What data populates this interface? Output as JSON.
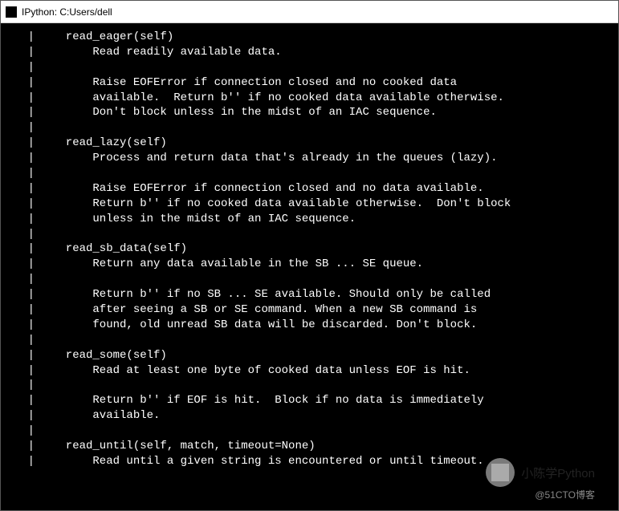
{
  "window": {
    "title": "IPython: C:Users/dell"
  },
  "doc": {
    "sections": [
      {
        "sig": "read_eager(self)",
        "body": [
          "Read readily available data.",
          "",
          "Raise EOFError if connection closed and no cooked data",
          "available.  Return b'' if no cooked data available otherwise.",
          "Don't block unless in the midst of an IAC sequence."
        ]
      },
      {
        "sig": "read_lazy(self)",
        "body": [
          "Process and return data that's already in the queues (lazy).",
          "",
          "Raise EOFError if connection closed and no data available.",
          "Return b'' if no cooked data available otherwise.  Don't block",
          "unless in the midst of an IAC sequence."
        ]
      },
      {
        "sig": "read_sb_data(self)",
        "body": [
          "Return any data available in the SB ... SE queue.",
          "",
          "Return b'' if no SB ... SE available. Should only be called",
          "after seeing a SB or SE command. When a new SB command is",
          "found, old unread SB data will be discarded. Don't block."
        ]
      },
      {
        "sig": "read_some(self)",
        "body": [
          "Read at least one byte of cooked data unless EOF is hit.",
          "",
          "Return b'' if EOF is hit.  Block if no data is immediately",
          "available."
        ]
      },
      {
        "sig": "read_until(self, match, timeout=None)",
        "body": [
          "Read until a given string is encountered or until timeout."
        ]
      }
    ],
    "pipe": "|",
    "sig_indent": "  ",
    "body_indent": "      "
  },
  "watermark": {
    "name": "小陈学Python",
    "handle": "@51CTO博客"
  }
}
